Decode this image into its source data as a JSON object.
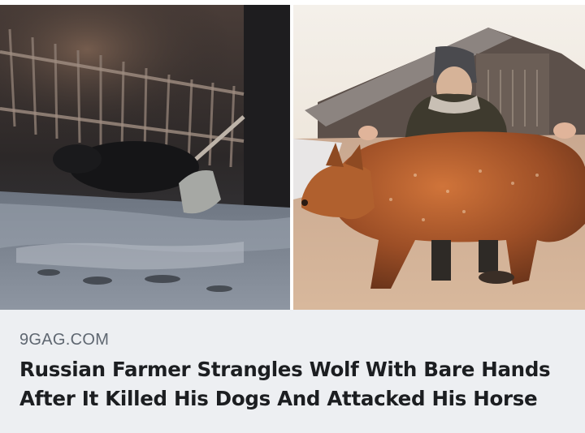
{
  "link_preview": {
    "domain": "9GAG.COM",
    "headline": "Russian Farmer Strangles Wolf With Bare Hands After It Killed His Dogs And Attacked His Horse"
  },
  "images": {
    "left": "night-cctv-photo",
    "right": "man-holding-wolf-photo"
  },
  "colors": {
    "footer_bg": "#edeff2",
    "domain_text": "#5f6771",
    "headline_text": "#1c1e21"
  }
}
